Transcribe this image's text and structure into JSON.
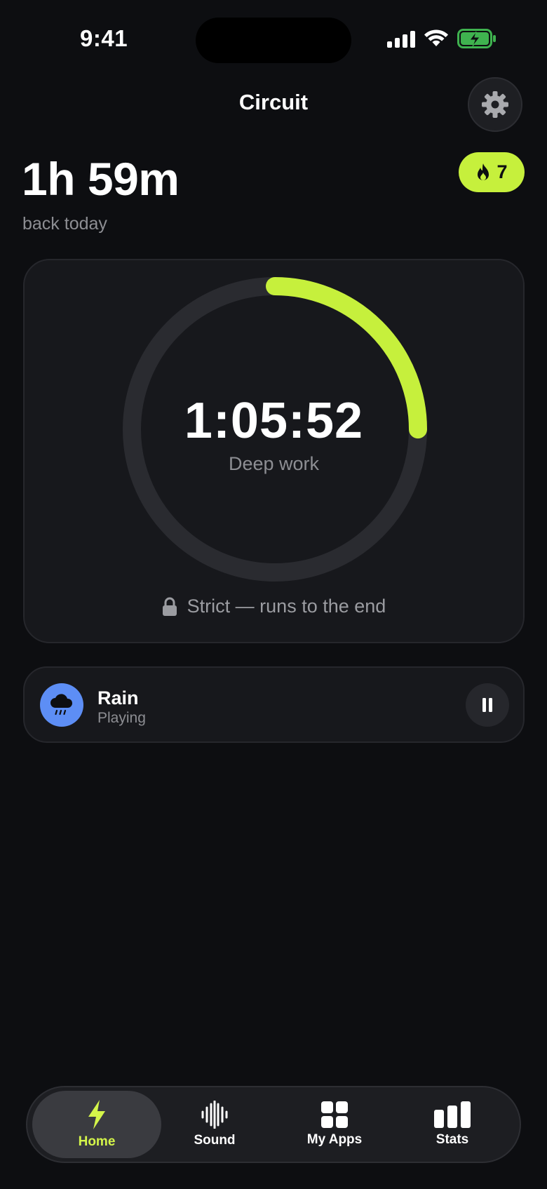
{
  "status_bar": {
    "time": "9:41",
    "icons": [
      "signal-icon",
      "wifi-icon",
      "battery-charging-icon"
    ]
  },
  "header": {
    "title": "Circuit",
    "settings_icon": "gear-icon"
  },
  "summary": {
    "time_back": "1h 59m",
    "time_back_label": "back today",
    "streak_count": "7",
    "streak_icon": "flame-icon"
  },
  "timer": {
    "value": "1:05:52",
    "mode": "Deep work",
    "progress_fraction": 0.25,
    "strict_label": "Strict — runs to the end",
    "accent": "#c6f03c"
  },
  "sound": {
    "name": "Rain",
    "status": "Playing",
    "icon": "rain-cloud-icon",
    "icon_color": "#5d8ef5"
  },
  "tabs": [
    {
      "label": "Home",
      "icon": "bolt-icon",
      "active": true
    },
    {
      "label": "Sound",
      "icon": "waveform-icon",
      "active": false
    },
    {
      "label": "My Apps",
      "icon": "grid-icon",
      "active": false
    },
    {
      "label": "Stats",
      "icon": "bar-chart-icon",
      "active": false
    }
  ]
}
